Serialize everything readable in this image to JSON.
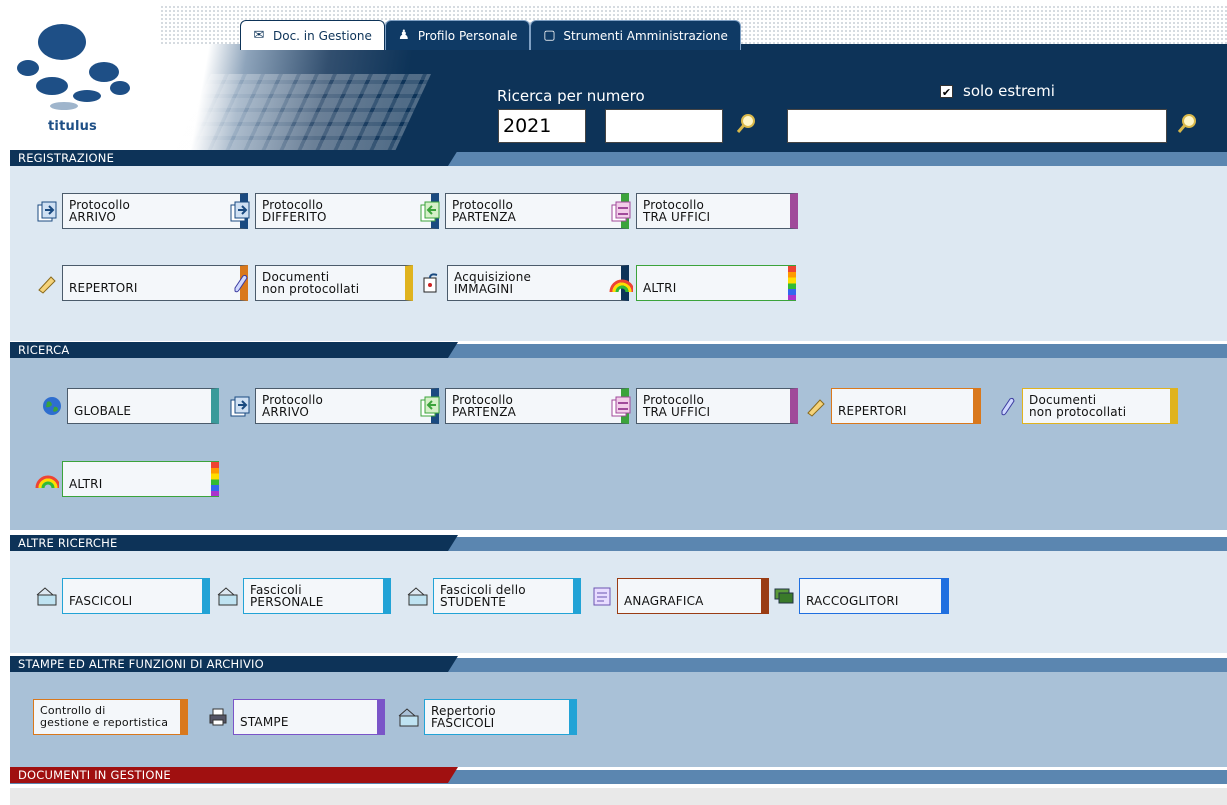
{
  "logo": {
    "text": "titulus"
  },
  "tabs": [
    {
      "label": "Doc. in Gestione",
      "icon": "envelope-icon"
    },
    {
      "label": "Profilo Personale",
      "icon": "person-icon"
    },
    {
      "label": "Strumenti Amministrazione",
      "icon": "folder-tools-icon"
    }
  ],
  "search": {
    "label": "Ricerca per numero",
    "year_value": "2021",
    "number_value": "",
    "text_value": "",
    "solo_estremi_label": "solo estremi",
    "solo_estremi_checked": true
  },
  "sections": {
    "registrazione": {
      "title": "REGISTRAZIONE",
      "buttons": [
        {
          "l1": "Protocollo",
          "l2": "ARRIVO"
        },
        {
          "l1": "Protocollo",
          "l2": "DIFFERITO"
        },
        {
          "l1": "Protocollo",
          "l2": "PARTENZA"
        },
        {
          "l1": "Protocollo",
          "l2": "TRA UFFICI"
        },
        {
          "l1": "REPERTORI"
        },
        {
          "l1": "Documenti",
          "l2": "non protocollati"
        },
        {
          "l1": "Acquisizione",
          "l2": "IMMAGINI"
        },
        {
          "l1": "ALTRI"
        }
      ]
    },
    "ricerca": {
      "title": "RICERCA",
      "buttons": [
        {
          "l1": "GLOBALE"
        },
        {
          "l1": "Protocollo",
          "l2": "ARRIVO"
        },
        {
          "l1": "Protocollo",
          "l2": "PARTENZA"
        },
        {
          "l1": "Protocollo",
          "l2": "TRA UFFICI"
        },
        {
          "l1": "REPERTORI"
        },
        {
          "l1": "Documenti",
          "l2": "non protocollati"
        },
        {
          "l1": "ALTRI"
        }
      ]
    },
    "altre": {
      "title": "ALTRE RICERCHE",
      "buttons": [
        {
          "l1": "FASCICOLI"
        },
        {
          "l1": "Fascicoli",
          "l2": "PERSONALE"
        },
        {
          "l1": "Fascicoli dello",
          "l2": "STUDENTE"
        },
        {
          "l1": "ANAGRAFICA"
        },
        {
          "l1": "RACCOGLITORI"
        }
      ]
    },
    "stampe": {
      "title": "STAMPE ED ALTRE FUNZIONI DI ARCHIVIO",
      "buttons": [
        {
          "l1": "Controllo di",
          "l2": "gestione e reportistica"
        },
        {
          "l1": "STAMPE"
        },
        {
          "l1": "Repertorio",
          "l2": "FASCICOLI"
        }
      ]
    },
    "documenti": {
      "title": "DOCUMENTI IN GESTIONE"
    }
  },
  "colors": {
    "navy": "#0d3358",
    "arrivo": "#1a4a80",
    "partenza": "#3ba33b",
    "uffici": "#a04a9a",
    "repertori": "#d9781c",
    "documenti": "#e0b31e",
    "globale": "#3a9a9a",
    "fascicoli": "#22a3d6",
    "anagrafica": "#9a3c14",
    "raccoglitori": "#1f6fe0",
    "stampe": "#7a55c8",
    "documenti_gestione": "#a01010"
  }
}
